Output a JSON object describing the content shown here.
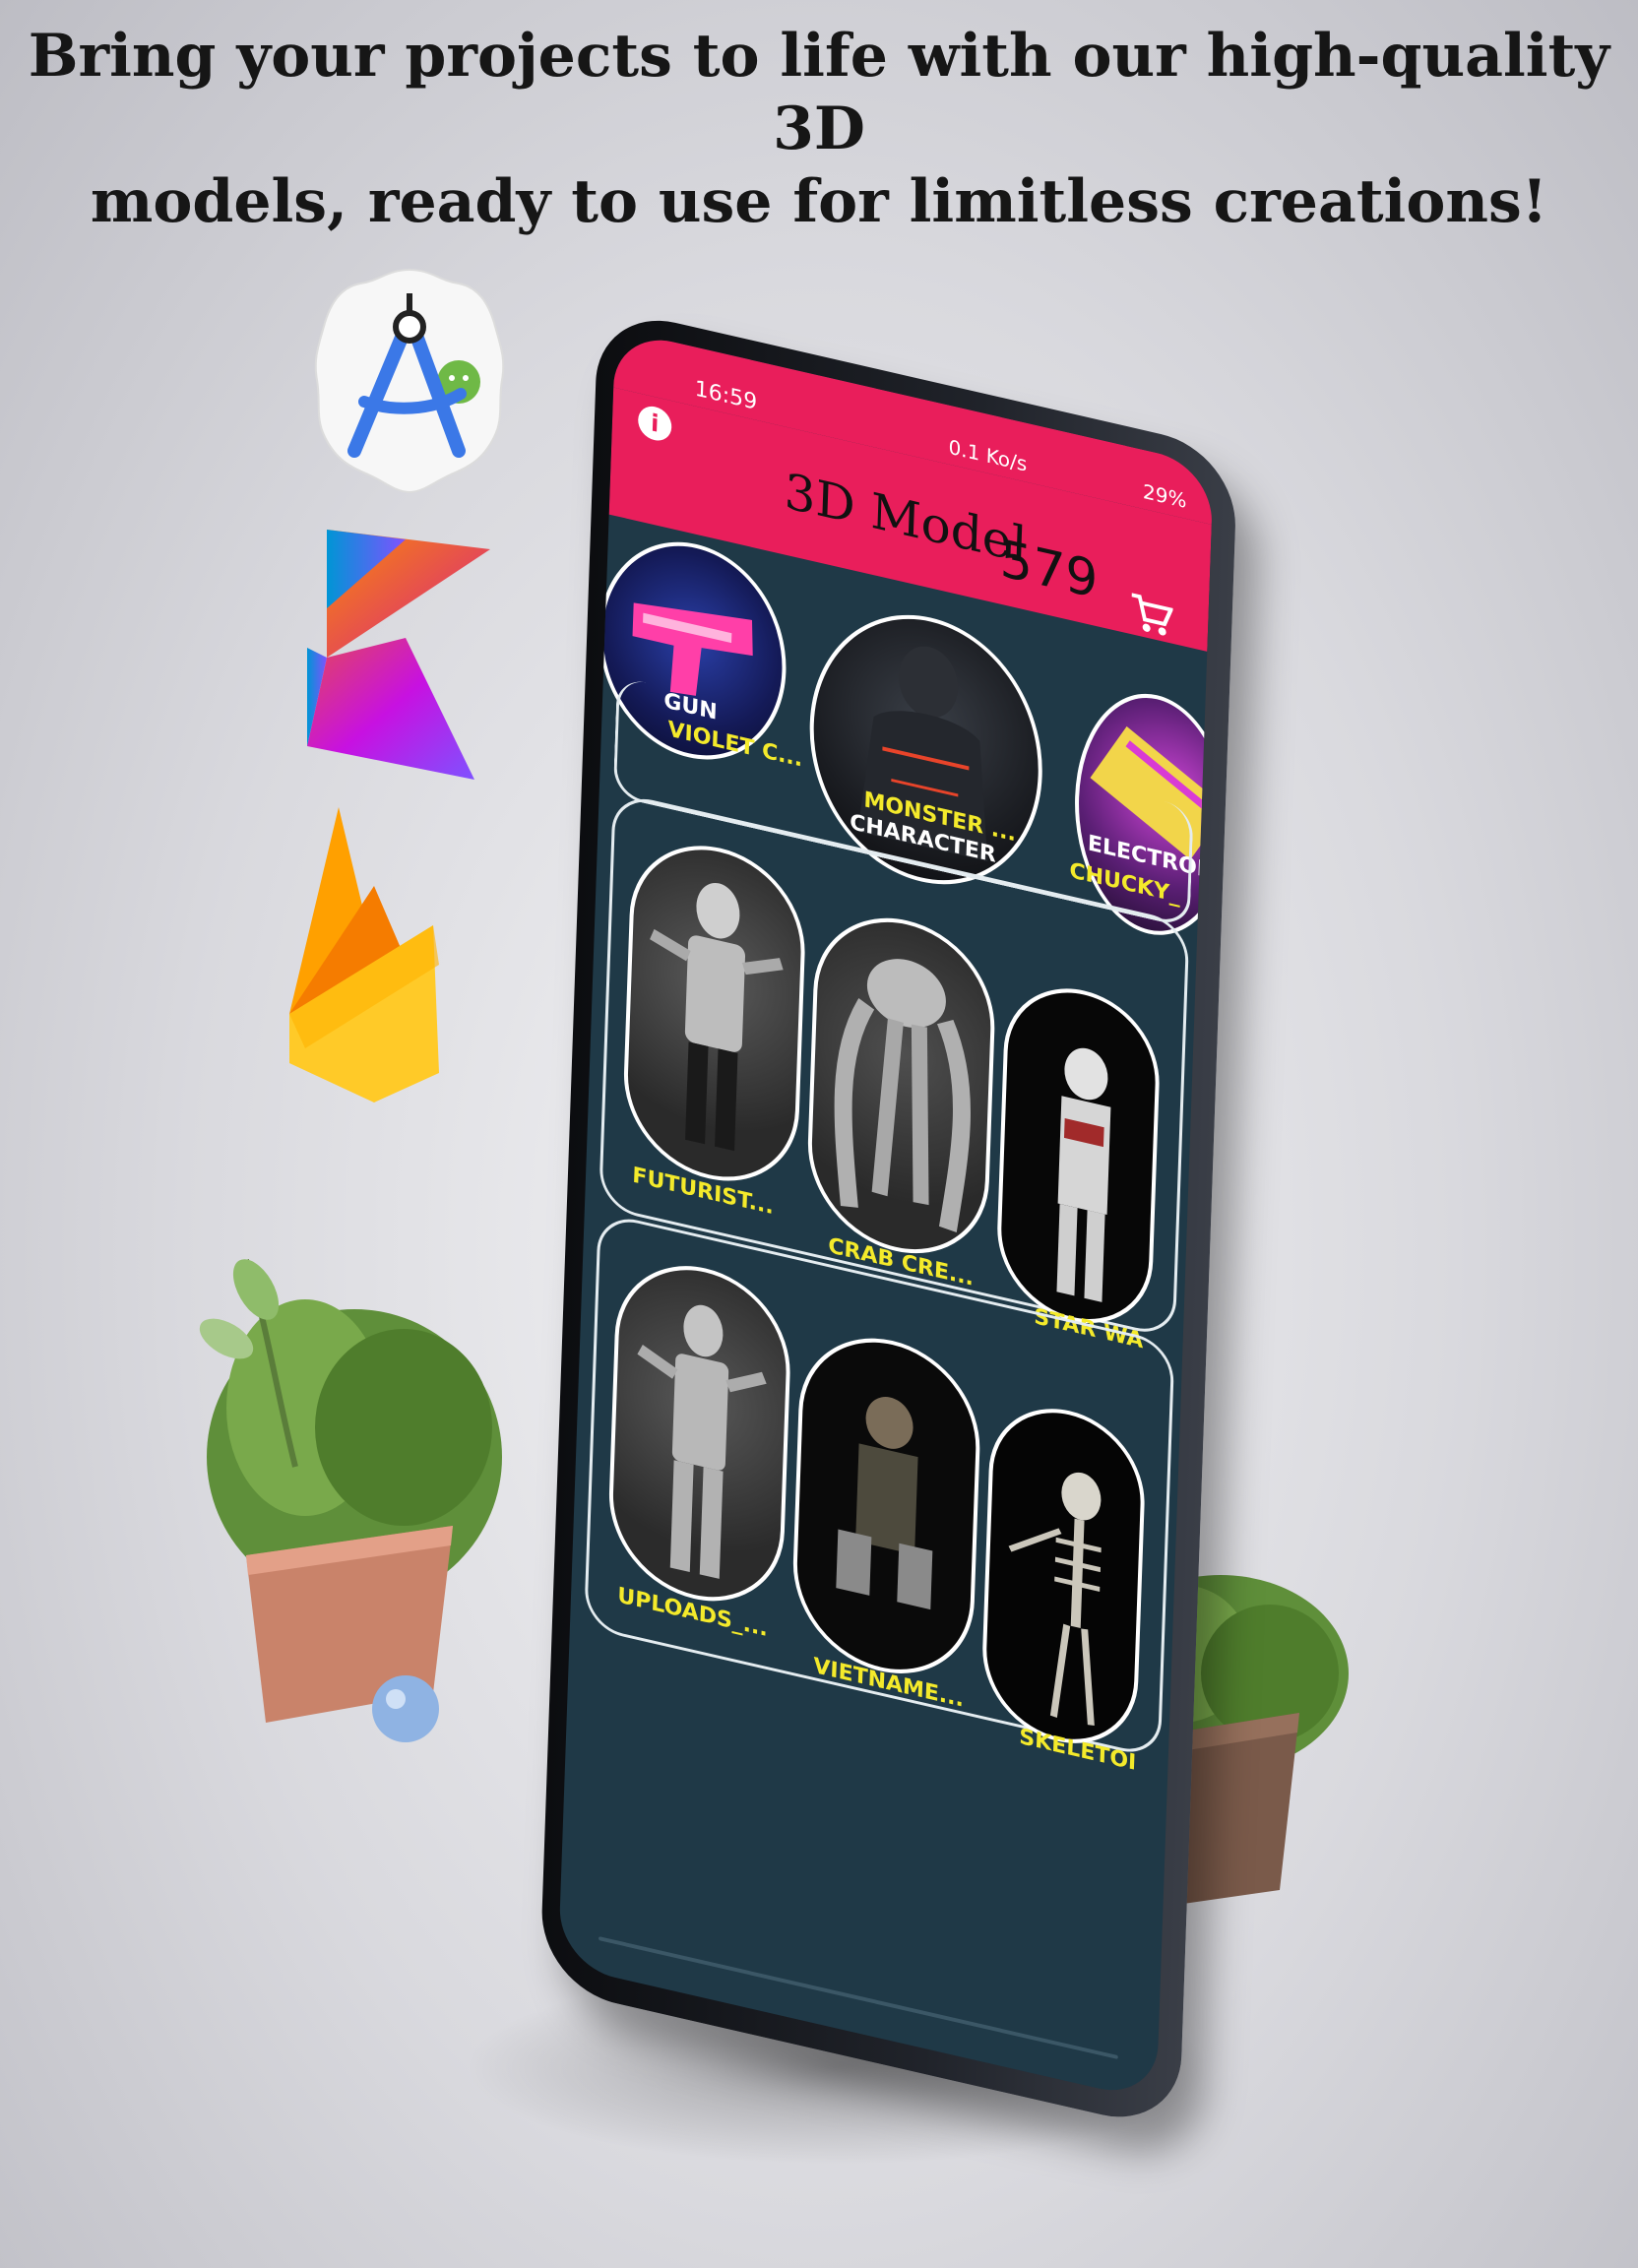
{
  "headline": {
    "line1": "Bring your projects to life with our high-quality 3D",
    "line2": "models, ready to use for limitless creations!"
  },
  "tech_logos": [
    "android-studio-icon",
    "kotlin-icon",
    "firebase-icon"
  ],
  "status_bar": {
    "time": "16:59",
    "network_speed": "0.1 Ko/s",
    "battery": "29%"
  },
  "app_bar": {
    "title": "3D Model",
    "model_count": "579",
    "info_icon": "info-icon",
    "cart_icon": "cart-icon"
  },
  "categories": [
    {
      "label": "GUN"
    },
    {
      "label": "CHARACTER"
    },
    {
      "label": "ELECTRON"
    }
  ],
  "category_names_row": [
    "VIOLET C...",
    "MONSTER ...",
    "CHUCKY_"
  ],
  "model_rows": [
    {
      "items": [
        {
          "name": "FUTURIST..."
        },
        {
          "name": "CRAB CRE..."
        },
        {
          "name": "STAR WA"
        }
      ]
    },
    {
      "items": [
        {
          "name": "UPLOADS_..."
        },
        {
          "name": "VIETNAME..."
        },
        {
          "name": "SKELETOI"
        }
      ]
    }
  ],
  "colors": {
    "accent": "#e91e5b",
    "screen_bg": "#1f3947",
    "label_yellow": "#f4ea2b",
    "card_border": "#ffffff"
  }
}
